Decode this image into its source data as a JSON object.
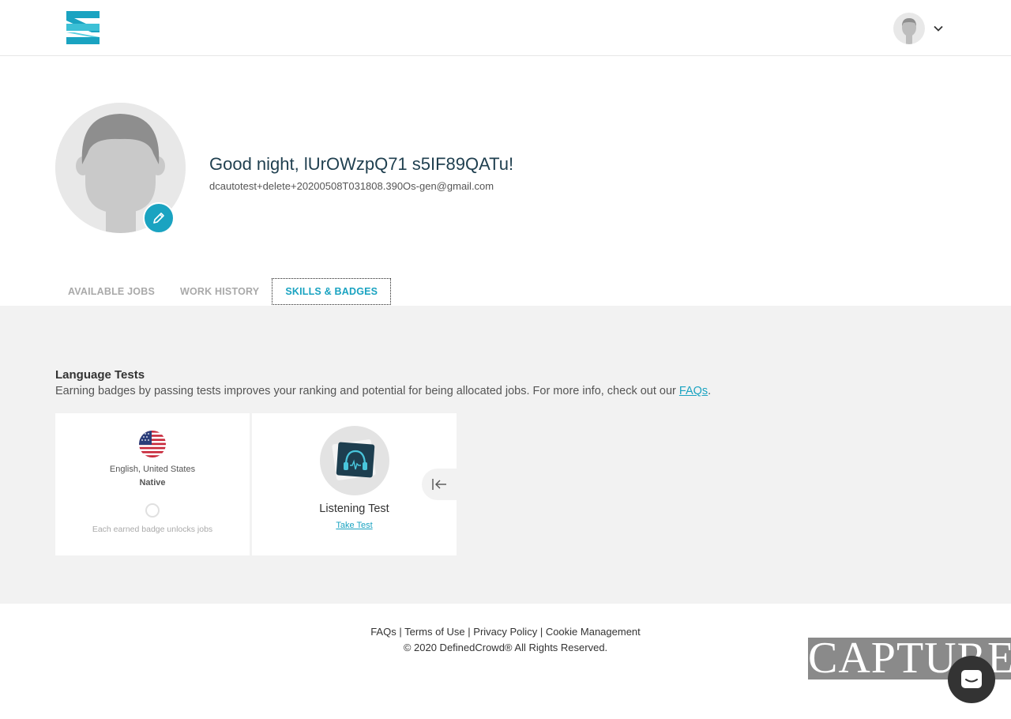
{
  "header": {
    "logo_icon": "definedcrowd-logo-icon",
    "avatar_icon": "user-avatar-icon",
    "menu_icon": "chevron-down-icon"
  },
  "profile": {
    "greeting": "Good night, lUrOWzpQ71 s5IF89QATu!",
    "email": "dcautotest+delete+20200508T031808.390Os-gen@gmail.com",
    "edit_icon": "pencil-icon"
  },
  "tabs": [
    {
      "label": "AVAILABLE JOBS",
      "active": false
    },
    {
      "label": "WORK HISTORY",
      "active": false
    },
    {
      "label": "SKILLS & BADGES",
      "active": true
    }
  ],
  "language_tests": {
    "title": "Language Tests",
    "description": "Earning badges by passing tests improves your ranking and potential for being allocated jobs. For more info, check out our ",
    "faq_link": "FAQs",
    "description_end": ".",
    "language_card": {
      "flag_icon": "us-flag-icon",
      "language": "English, United States",
      "level": "Native",
      "note": "Each earned badge unlocks jobs"
    },
    "listening_card": {
      "icon": "headphones-icon",
      "title": "Listening Test",
      "action": "Take Test",
      "collapse_icon": "collapse-left-icon"
    }
  },
  "footer": {
    "links": [
      "FAQs",
      "Terms of Use",
      "Privacy Policy",
      "Cookie Management"
    ],
    "separator": " | ",
    "copyright": "© 2020 DefinedCrowd® All Rights Reserved."
  },
  "watermark": "CAPTURE",
  "chat": {
    "icon": "chat-icon"
  },
  "colors": {
    "accent": "#1aa3c1",
    "heading": "#1f3f4f",
    "section_bg": "#f2f2f2"
  }
}
